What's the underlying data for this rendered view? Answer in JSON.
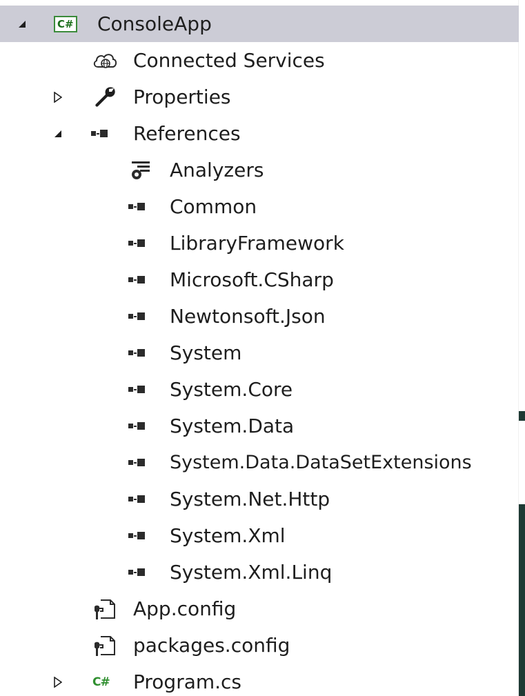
{
  "solution_explorer": {
    "project": {
      "label": "ConsoleApp",
      "icon": "csharp-project-icon",
      "expanded": true
    },
    "items": {
      "connected_services": {
        "label": "Connected Services",
        "icon": "cloud-globe-icon"
      },
      "properties": {
        "label": "Properties",
        "icon": "wrench-icon",
        "expanded": false
      },
      "references": {
        "label": "References",
        "icon": "reference-icon",
        "expanded": true,
        "children": [
          {
            "label": "Analyzers",
            "icon": "analyzer-icon"
          },
          {
            "label": "Common",
            "icon": "reference-icon"
          },
          {
            "label": "LibraryFramework",
            "icon": "reference-icon"
          },
          {
            "label": "Microsoft.CSharp",
            "icon": "reference-icon"
          },
          {
            "label": "Newtonsoft.Json",
            "icon": "reference-icon"
          },
          {
            "label": "System",
            "icon": "reference-icon"
          },
          {
            "label": "System.Core",
            "icon": "reference-icon"
          },
          {
            "label": "System.Data",
            "icon": "reference-icon"
          },
          {
            "label": "System.Data.DataSetExtensions",
            "icon": "reference-icon"
          },
          {
            "label": "System.Net.Http",
            "icon": "reference-icon"
          },
          {
            "label": "System.Xml",
            "icon": "reference-icon"
          },
          {
            "label": "System.Xml.Linq",
            "icon": "reference-icon"
          }
        ]
      },
      "app_config": {
        "label": "App.config",
        "icon": "config-file-icon"
      },
      "packages_config": {
        "label": "packages.config",
        "icon": "config-file-icon"
      },
      "program_cs": {
        "label": "Program.cs",
        "icon": "csharp-file-icon",
        "expanded": false
      }
    },
    "project_icon_text": "C#",
    "file_icon_text": "C#"
  },
  "colors": {
    "selected_row": "#ccccd6",
    "csharp_green": "#2f8f2f",
    "text": "#1e1e1e"
  }
}
